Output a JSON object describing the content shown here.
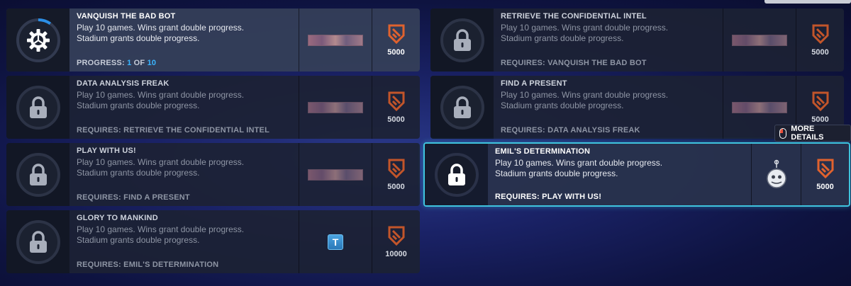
{
  "cards_left": [
    {
      "title": "VANQUISH THE BAD BOT",
      "desc1": "Play 10 games. Wins grant double progress.",
      "desc2": "Stadium grants double progress.",
      "progress_label": "PROGRESS: ",
      "progress_current": "1",
      "progress_sep": " OF ",
      "progress_total": "10",
      "progress_fraction": 0.1,
      "reward": "spray",
      "points": "5000",
      "icon": "cog-icon",
      "state": "active"
    },
    {
      "title": "DATA ANALYSIS FREAK",
      "desc1": "Play 10 games. Wins grant double progress.",
      "desc2": "Stadium grants double progress.",
      "req": "REQUIRES: RETRIEVE THE CONFIDENTIAL INTEL",
      "reward": "spray",
      "points": "5000",
      "icon": "lock-icon",
      "state": "locked"
    },
    {
      "title": "PLAY WITH US!",
      "desc1": "Play 10 games. Wins grant double progress.",
      "desc2": "Stadium grants double progress.",
      "req": "REQUIRES: FIND A PRESENT",
      "reward": "spray",
      "points": "5000",
      "icon": "lock-icon",
      "state": "locked"
    },
    {
      "title": "GLORY TO MANKIND",
      "desc1": "Play 10 games. Wins grant double progress.",
      "desc2": "Stadium grants double progress.",
      "req": "REQUIRES: EMIL'S DETERMINATION",
      "reward": "title",
      "reward_letter": "T",
      "points": "10000",
      "icon": "lock-icon",
      "state": "locked"
    }
  ],
  "cards_right": [
    {
      "title": "RETRIEVE THE CONFIDENTIAL INTEL",
      "desc1": "Play 10 games. Wins grant double progress.",
      "desc2": "Stadium grants double progress.",
      "req": "REQUIRES: VANQUISH THE BAD BOT",
      "reward": "spray",
      "points": "5000",
      "icon": "lock-icon",
      "state": "locked"
    },
    {
      "title": "FIND A PRESENT",
      "desc1": "Play 10 games. Wins grant double progress.",
      "desc2": "Stadium grants double progress.",
      "req": "REQUIRES: DATA ANALYSIS FREAK",
      "reward": "spray",
      "points": "5000",
      "icon": "lock-icon",
      "state": "locked"
    },
    {
      "title": "EMIL'S DETERMINATION",
      "desc1": "Play 10 games. Wins grant double progress.",
      "desc2": "Stadium grants double progress.",
      "req": "REQUIRES: PLAY WITH US!",
      "reward": "icon",
      "points": "5000",
      "icon": "lock-icon",
      "state": "highlight"
    }
  ],
  "more_details": "MORE DETAILS",
  "colors": {
    "accent_cyan": "#3fc4de",
    "progress_blue": "#3ab5ff",
    "points_orange": "#e0622e"
  }
}
